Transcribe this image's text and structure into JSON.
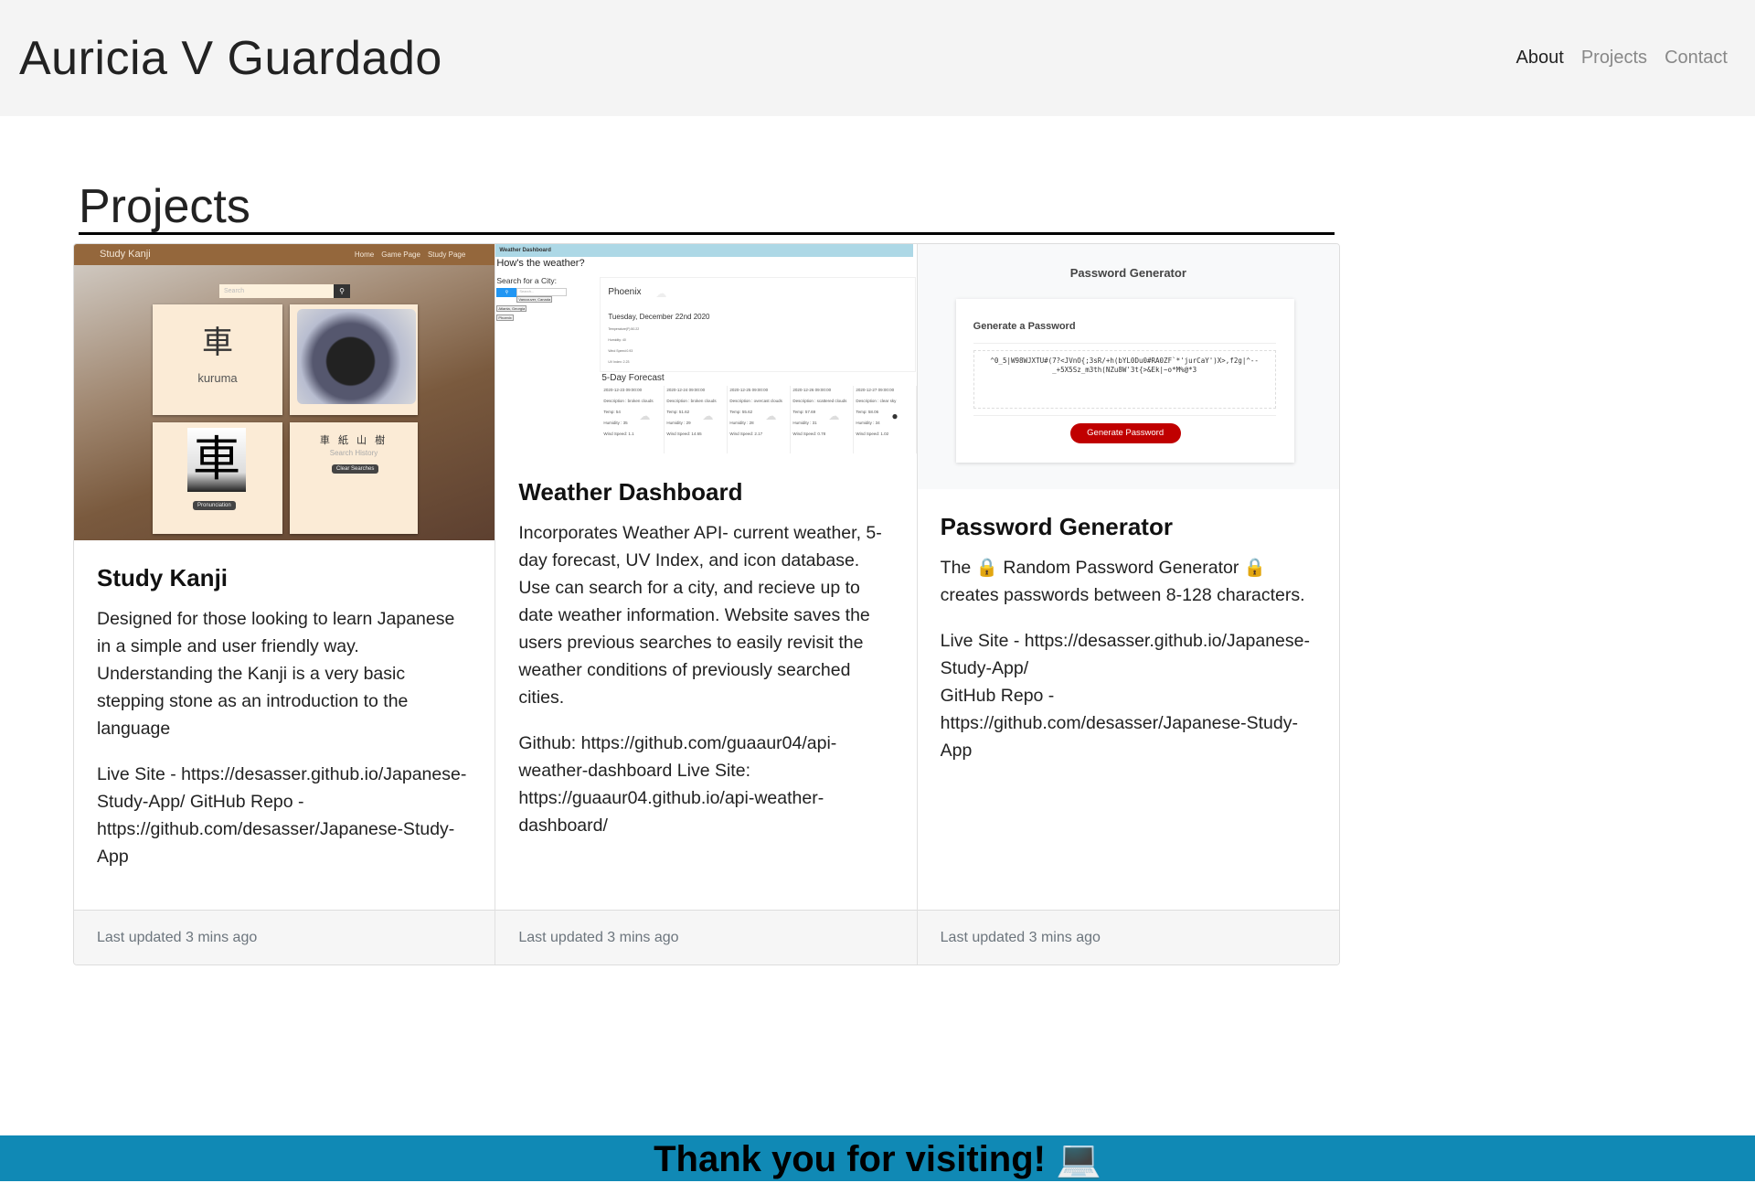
{
  "header": {
    "brand": "Auricia V Guardado",
    "nav": [
      {
        "label": "About",
        "active": true
      },
      {
        "label": "Projects",
        "active": false
      },
      {
        "label": "Contact",
        "active": false
      }
    ]
  },
  "section_title": "Projects",
  "cards": [
    {
      "title": "Study Kanji",
      "text": "Designed for those looking to learn Japanese in a simple and user friendly way. Understanding the Kanji is a very basic stepping stone as an introduction to the language",
      "links": "Live Site - https://desasser.github.io/Japanese-Study-App/ GitHub Repo - https://github.com/desasser/Japanese-Study-App",
      "footer": "Last updated 3 mins ago",
      "screenshot": {
        "app_title": "Study Kanji",
        "nav": [
          "Home",
          "Game Page",
          "Study Page"
        ],
        "search_placeholder": "Search",
        "kanji": "車",
        "reading": "kuruma",
        "history": [
          "車",
          "紙",
          "山",
          "樹"
        ],
        "history_label": "Search History",
        "clear_button": "Clear Searches",
        "pronounce_button": "Pronunciation"
      }
    },
    {
      "title": "Weather Dashboard",
      "text": "Incorporates Weather API- current weather, 5-day forecast, UV Index, and icon database. Use can search for a city, and recieve up to date weather information. Website saves the users previous searches to easily revisit the weather conditions of previously searched cities.",
      "links": "Github: https://github.com/guaaur04/api-weather-dashboard Live Site: https://guaaur04.github.io/api-weather-dashboard/",
      "footer": "Last updated 3 mins ago",
      "screenshot": {
        "bar_title": "Weather Dashboard",
        "heading": "How's the weather?",
        "search_label": "Search for a City:",
        "search_placeholder": "Search...",
        "history": [
          "Vancouver, Canada",
          "Atlanta, Georgia",
          "Phoenix"
        ],
        "city": "Phoenix",
        "date": "Tuesday, December 22nd 2020",
        "current": [
          "Temperature(F):50.22",
          "Humidity: 40",
          "Wind Speed:0.93",
          "UV Index: 2.23"
        ],
        "forecast_title": "5-Day Forecast",
        "forecast": [
          {
            "date": "2020-12-23 09:00:00",
            "desc": "Description : broken clouds",
            "temp": "Temp: 54",
            "hum": "Humidity : 35",
            "wind": "Wind Speed: 1.1"
          },
          {
            "date": "2020-12-24 09:00:00",
            "desc": "Description : broken clouds",
            "temp": "Temp: 51.62",
            "hum": "Humidity : 29",
            "wind": "Wind Speed: 14.65"
          },
          {
            "date": "2020-12-25 09:00:00",
            "desc": "Description : overcast clouds",
            "temp": "Temp: 55.62",
            "hum": "Humidity : 28",
            "wind": "Wind Speed: 2.17"
          },
          {
            "date": "2020-12-26 09:00:00",
            "desc": "Description : scattered clouds",
            "temp": "Temp: 57.69",
            "hum": "Humidity : 31",
            "wind": "Wind Speed: 0.78"
          },
          {
            "date": "2020-12-27 09:00:00",
            "desc": "Description : clear sky",
            "temp": "Temp: 58.06",
            "hum": "Humidity : 34",
            "wind": "Wind Speed: 1.02"
          }
        ]
      }
    },
    {
      "title": "Password Generator",
      "text": "The 🔒 Random Password Generator 🔒 creates passwords between 8-128 characters.",
      "links": "Live Site - https://desasser.github.io/Japanese-Study-App/",
      "links2": "GitHub Repo - https://github.com/desasser/Japanese-Study-App",
      "footer": "Last updated 3 mins ago",
      "screenshot": {
        "title": "Password Generator",
        "subtitle": "Generate a Password",
        "password": "^0_5|W98WJXTU#(7?<JVnO{;3sR/+h(bYL0Du0#RA0ZF`*'jurCaY')X>,f2g|^--_+5X5Sz_m3th(NZu8W'3t{>&Ek|~o*M%@*3",
        "button": "Generate Password"
      }
    }
  ],
  "footer": {
    "text": "Thank you for visiting! 💻"
  },
  "colors": {
    "header_bg": "#f4f4f4",
    "footer_bg": "#1089b5",
    "button_red": "#c00000"
  }
}
